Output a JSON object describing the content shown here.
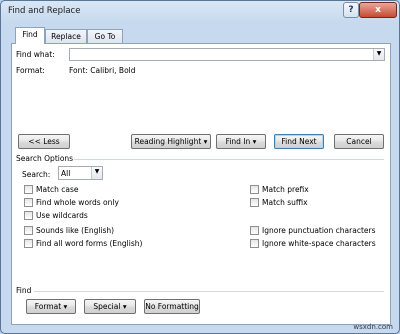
{
  "window": {
    "title": "Find and Replace",
    "help_label": "?",
    "close_label": "x"
  },
  "tabs": [
    {
      "label": "Find"
    },
    {
      "label": "Replace"
    },
    {
      "label": "Go To"
    }
  ],
  "find_what": {
    "label": "Find what:",
    "value": ""
  },
  "format": {
    "label": "Format:",
    "value": "Font: Calibri, Bold"
  },
  "buttons": {
    "less": "<< Less",
    "reading_highlight": "Reading Highlight",
    "find_in": "Find In",
    "find_next": "Find Next",
    "cancel": "Cancel",
    "format": "Format",
    "special": "Special",
    "no_formatting": "No Formatting"
  },
  "search_options": {
    "heading": "Search Options",
    "search_label": "Search:",
    "search_value": "All",
    "left": [
      {
        "label": "Match case",
        "checked": false
      },
      {
        "label": "Find whole words only",
        "checked": false
      },
      {
        "label": "Use wildcards",
        "checked": false
      },
      {
        "label": "Sounds like (English)",
        "checked": false
      },
      {
        "label": "Find all word forms (English)",
        "checked": false
      }
    ],
    "right": [
      {
        "label": "Match prefix",
        "checked": false
      },
      {
        "label": "Match suffix",
        "checked": false
      },
      {
        "label": "Ignore punctuation characters",
        "checked": false
      },
      {
        "label": "Ignore white-space characters",
        "checked": false
      }
    ]
  },
  "find_section": {
    "heading": "Find"
  },
  "icons": {
    "dropdown": "▾",
    "combo_arrow": "▼"
  },
  "watermark": "wsxdn.com"
}
